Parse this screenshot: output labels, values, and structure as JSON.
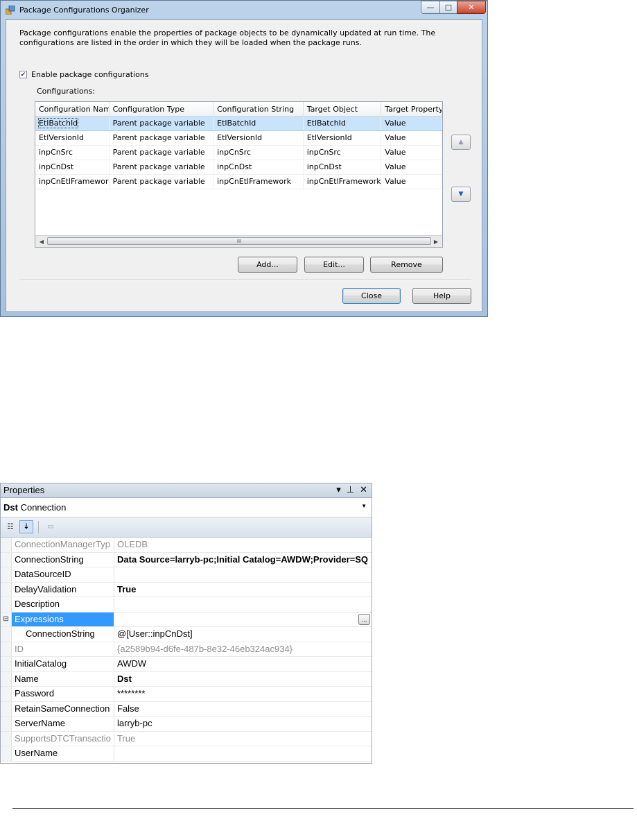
{
  "dialog": {
    "title": "Package Configurations Organizer",
    "description": "Package configurations enable the properties of package objects to be dynamically updated at run time. The configurations are listed in the order in which they will be loaded when the package runs.",
    "enable_label": "Enable package configurations",
    "enable_checked": true,
    "configurations_label": "Configurations:",
    "columns": [
      "Configuration Name",
      "Configuration Type",
      "Configuration String",
      "Target Object",
      "Target Property"
    ],
    "rows": [
      [
        "EtlBatchId",
        "Parent package variable",
        "EtlBatchId",
        "EtlBatchId",
        "Value"
      ],
      [
        "EtlVersionId",
        "Parent package variable",
        "EtlVersionId",
        "EtlVersionId",
        "Value"
      ],
      [
        "inpCnSrc",
        "Parent package variable",
        "inpCnSrc",
        "inpCnSrc",
        "Value"
      ],
      [
        "inpCnDst",
        "Parent package variable",
        "inpCnDst",
        "inpCnDst",
        "Value"
      ],
      [
        "inpCnEtlFramework",
        "Parent package variable",
        "inpCnEtlFramework",
        "inpCnEtlFramework",
        "Value"
      ]
    ],
    "selected_row": 0,
    "scroll_grip": "III",
    "buttons": {
      "add": "Add...",
      "edit": "Edit...",
      "remove": "Remove",
      "close": "Close",
      "help": "Help"
    },
    "window_controls": {
      "minimize": "—",
      "maximize": "□",
      "close": "✕"
    }
  },
  "properties": {
    "title": "Properties",
    "object_name": "Dst",
    "object_type": "Connection",
    "rows": [
      {
        "name": "ConnectionManagerTyp",
        "value": "OLEDB",
        "style": "readonly"
      },
      {
        "name": "ConnectionString",
        "value": "Data Source=larryb-pc;Initial Catalog=AWDW;Provider=SQ",
        "style": "bold"
      },
      {
        "name": "DataSourceID",
        "value": "",
        "style": "normal"
      },
      {
        "name": "DelayValidation",
        "value": "True",
        "style": "bold"
      },
      {
        "name": "Description",
        "value": "",
        "style": "normal"
      },
      {
        "name": "Expressions",
        "value": "",
        "style": "selected",
        "expander": "⊟",
        "ellipsis": "..."
      },
      {
        "name": "ConnectionString",
        "value": "@[User::inpCnDst]",
        "style": "sub"
      },
      {
        "name": "ID",
        "value": "{a2589b94-d6fe-487b-8e32-46eb324ac934}",
        "style": "readonly"
      },
      {
        "name": "InitialCatalog",
        "value": "AWDW",
        "style": "normal"
      },
      {
        "name": "Name",
        "value": "Dst",
        "style": "bold"
      },
      {
        "name": "Password",
        "value": "********",
        "style": "normal"
      },
      {
        "name": "RetainSameConnection",
        "value": "False",
        "style": "normal"
      },
      {
        "name": "ServerName",
        "value": "larryb-pc",
        "style": "normal"
      },
      {
        "name": "SupportsDTCTransactio",
        "value": "True",
        "style": "readonly"
      },
      {
        "name": "UserName",
        "value": "",
        "style": "normal"
      }
    ]
  },
  "colors": {
    "selection_row": "#c9e3fa",
    "selected_property": "#3399ff",
    "readonly_text": "#8d8d8d"
  }
}
